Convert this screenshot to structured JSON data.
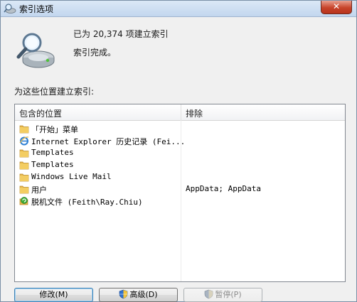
{
  "window": {
    "title": "索引选项",
    "close_symbol": "✕"
  },
  "status": {
    "indexed_count_line": "已为 20,374 项建立索引",
    "complete_line": "索引完成。",
    "icon": "magnifier-drive-icon"
  },
  "locations": {
    "label": "为这些位置建立索引:",
    "columns": {
      "included": "包含的位置",
      "exclude": "排除"
    },
    "rows": [
      {
        "name": "「开始」菜单",
        "exclude": "",
        "icon": "folder-icon"
      },
      {
        "name": "Internet Explorer 历史记录 (Fei...",
        "exclude": "",
        "icon": "ie-icon"
      },
      {
        "name": "Templates",
        "exclude": "",
        "icon": "folder-icon"
      },
      {
        "name": "Templates",
        "exclude": "",
        "icon": "folder-icon"
      },
      {
        "name": "Windows Live Mail",
        "exclude": "",
        "icon": "folder-icon"
      },
      {
        "name": "用户",
        "exclude": "AppData; AppData",
        "icon": "folder-icon"
      },
      {
        "name": "脱机文件 (Feith\\Ray.Chiu)",
        "exclude": "",
        "icon": "sync-icon"
      }
    ]
  },
  "buttons": {
    "modify": "修改(M)",
    "advanced": "高级(D)",
    "pause": "暂停(P)"
  },
  "colors": {
    "title_bar": "#c2d6ee",
    "close_button": "#c7442a",
    "folder": "#e8b84a"
  }
}
